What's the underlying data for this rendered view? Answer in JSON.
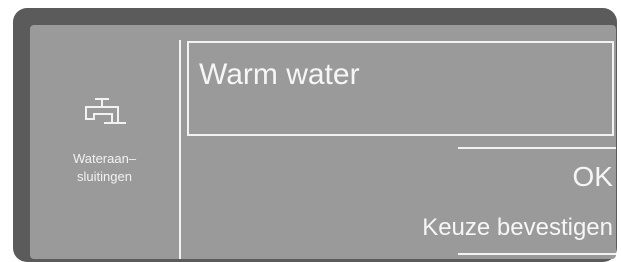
{
  "sidebar": {
    "icon": "water-tap-icon",
    "label_line1": "Wateraan–",
    "label_line2": "sluitingen"
  },
  "menu": {
    "selected_item": "Warm water"
  },
  "actions": {
    "ok_label": "OK",
    "confirm_hint": "Keuze bevestigen"
  },
  "colors": {
    "bezel": "#5b5b5b",
    "screen_background": "#9a9a9a",
    "foreground": "#f2f2f2"
  }
}
